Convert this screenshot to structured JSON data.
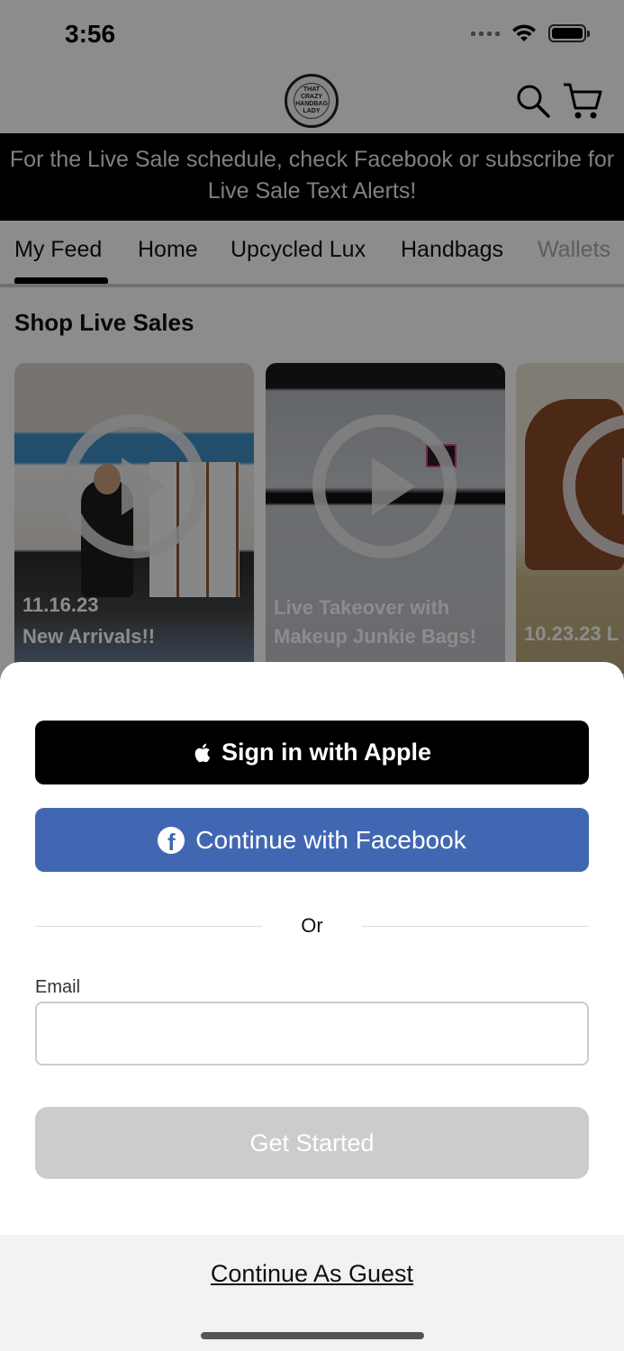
{
  "status_bar": {
    "time": "3:56"
  },
  "header": {
    "logo_text": "THAT CRAZY HANDBAG LADY",
    "search_icon": "search-icon",
    "cart_icon": "cart-icon"
  },
  "banner": {
    "text": "For the Live Sale schedule, check Facebook or subscribe for Live Sale Text Alerts!"
  },
  "tabs": [
    {
      "label": "My Feed",
      "active": true
    },
    {
      "label": "Home"
    },
    {
      "label": "Upcycled Lux"
    },
    {
      "label": "Handbags"
    },
    {
      "label": "Wallets"
    }
  ],
  "section": {
    "title": "Shop Live Sales"
  },
  "cards": [
    {
      "date": "11.16.23",
      "title": "New Arrivals!!"
    },
    {
      "date": "",
      "title": "Live Takeover with Makeup Junkie Bags!"
    },
    {
      "date": "10.23.23 L",
      "title": ""
    }
  ],
  "sheet": {
    "apple_label": "Sign in with Apple",
    "facebook_label": "Continue with Facebook",
    "or_label": "Or",
    "email_label": "Email",
    "email_value": "",
    "email_placeholder": "",
    "get_started_label": "Get Started",
    "guest_label": "Continue As Guest"
  },
  "colors": {
    "facebook": "#4267b2",
    "apple": "#000000",
    "disabled_button": "#cccccc",
    "banner": "#000000"
  }
}
